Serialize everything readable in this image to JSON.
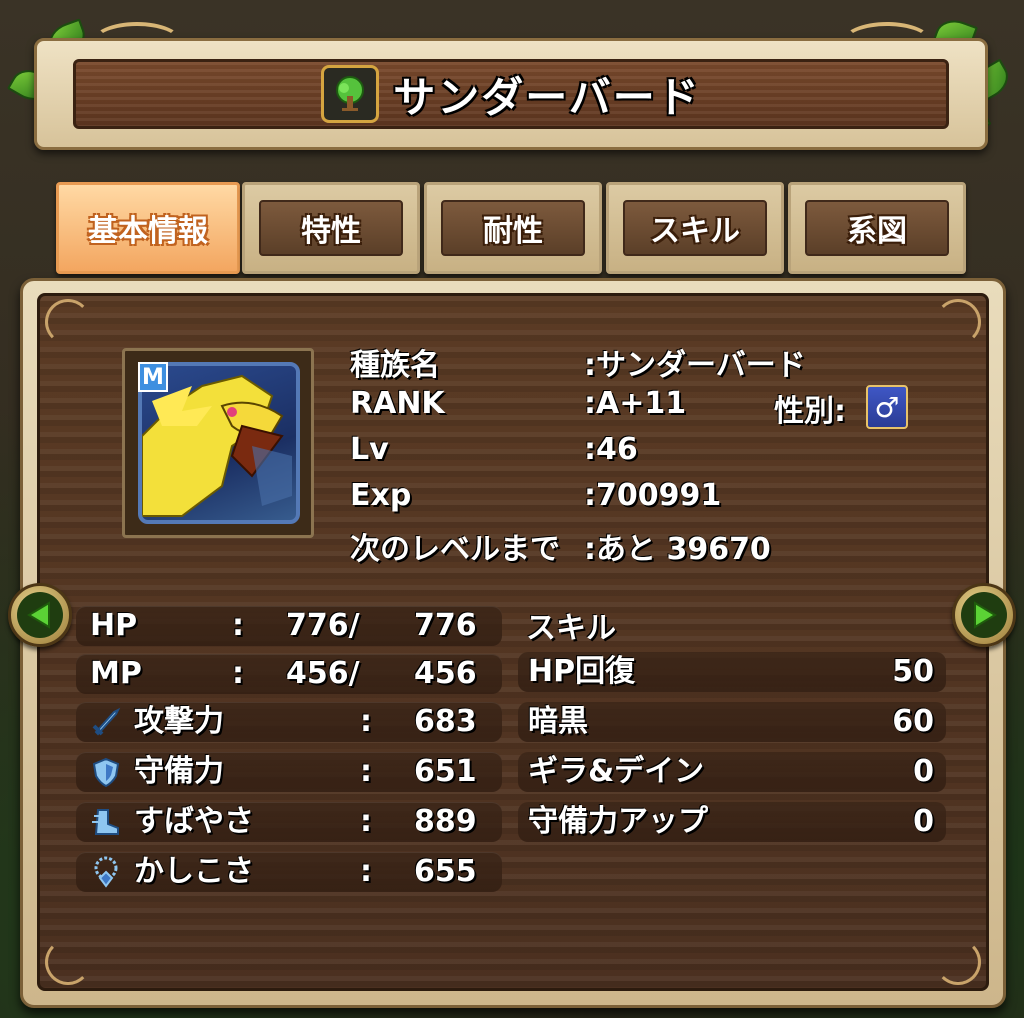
{
  "header": {
    "family_icon": "tree-icon",
    "title": "サンダーバード"
  },
  "tabs": [
    {
      "label": "基本情報",
      "active": true
    },
    {
      "label": "特性",
      "active": false
    },
    {
      "label": "耐性",
      "active": false
    },
    {
      "label": "スキル",
      "active": false
    },
    {
      "label": "系図",
      "active": false
    }
  ],
  "portrait": {
    "badge": "M",
    "icon": "thunderbird-portrait"
  },
  "info": {
    "species_label": "種族名",
    "species_value": ":サンダーバード",
    "rank_label": "RANK",
    "rank_value": ":A+11",
    "gender_label": "性別:",
    "gender_symbol": "♂",
    "lv_label": "Lv",
    "lv_value": ":46",
    "exp_label": "Exp",
    "exp_value": ":700991",
    "next_label": "次のレベルまで",
    "next_value": ":あと 39670"
  },
  "stats": [
    {
      "name": "HP",
      "sep": ":",
      "current": "776/",
      "max": "776"
    },
    {
      "name": "MP",
      "sep": ":",
      "current": "456/",
      "max": "456"
    },
    {
      "name": "攻撃力",
      "sep": ":",
      "value": "683",
      "icon": "sword-icon"
    },
    {
      "name": "守備力",
      "sep": ":",
      "value": "651",
      "icon": "shield-icon"
    },
    {
      "name": "すばやさ",
      "sep": ":",
      "value": "889",
      "icon": "boot-icon"
    },
    {
      "name": "かしこさ",
      "sep": ":",
      "value": "655",
      "icon": "amulet-icon"
    }
  ],
  "skills": {
    "header": "スキル",
    "items": [
      {
        "name": "HP回復",
        "value": "50"
      },
      {
        "name": "暗黒",
        "value": "60"
      },
      {
        "name": "ギラ&デイン",
        "value": "0"
      },
      {
        "name": "守備力アップ",
        "value": "0"
      }
    ]
  },
  "colors": {
    "panel_wood": "#4b3020",
    "tab_active": "#f3a660",
    "frame_cream": "#e9dcbc",
    "gender_blue": "#3f57c5"
  }
}
